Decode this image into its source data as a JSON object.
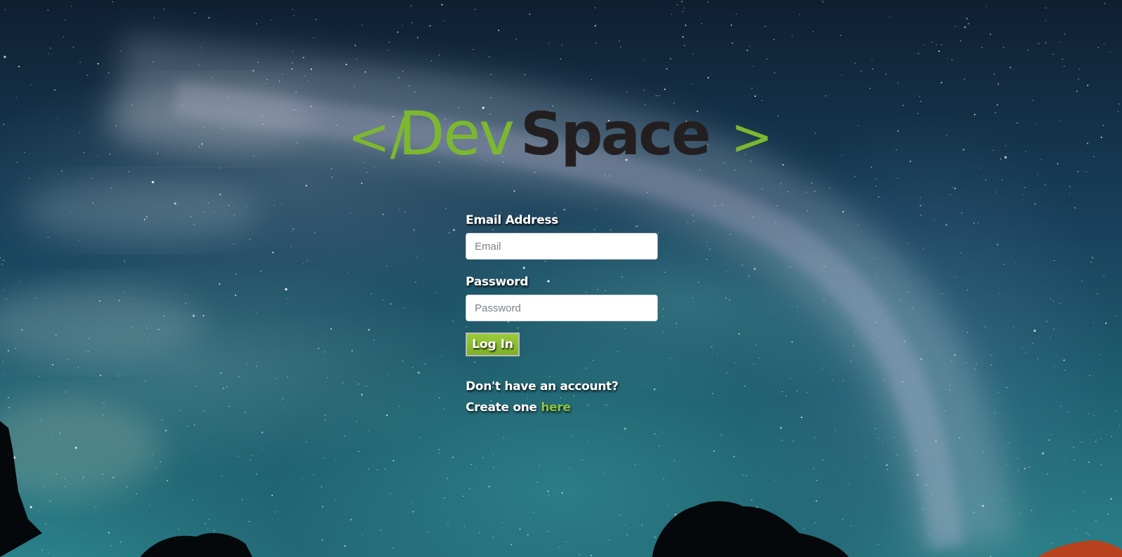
{
  "logo": {
    "prefix": "</",
    "dev": "Dev",
    "space": "Space",
    "suffix": ">",
    "green": "#7cb82f",
    "dark": "#231f20"
  },
  "login_form": {
    "email_label": "Email Address",
    "email_placeholder": "Email",
    "email_value": "",
    "password_label": "Password",
    "password_placeholder": "Password",
    "password_value": "",
    "submit_label": "Log In"
  },
  "signup_prompt": {
    "question": "Don't have an account?",
    "create_text": "Create one ",
    "link_text": "here"
  },
  "colors": {
    "accent": "#8cc43c",
    "button": "#8bbd33"
  }
}
